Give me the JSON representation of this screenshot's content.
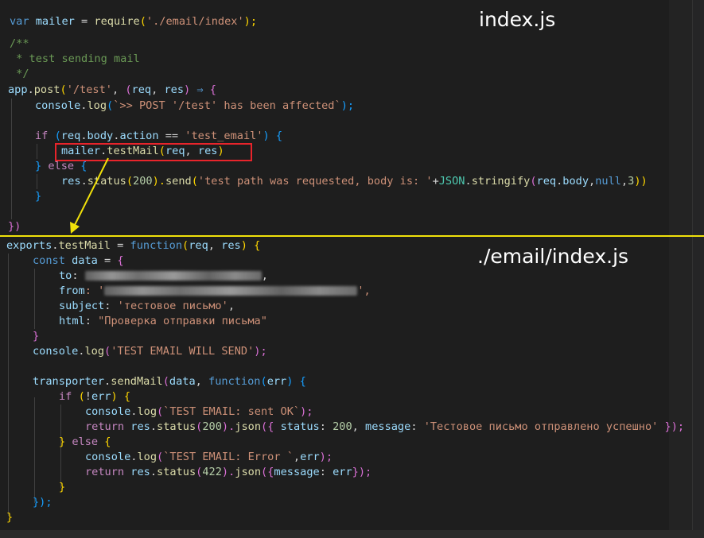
{
  "labels": {
    "top_file": "index.js",
    "bottom_file": "./email/index.js"
  },
  "colors": {
    "divider": "#f1e10a",
    "highlight_box": "#e8242b",
    "arrow": "#f1e10a",
    "background": "#1e1e1e"
  },
  "top": {
    "l1": {
      "a": "var",
      "b": "mailer",
      "c": " = ",
      "d": "require",
      "e": "(",
      "f": "'./email/index'",
      "g": ");"
    },
    "l2": {
      "a": "/**"
    },
    "l3": {
      "a": " * test sending mail"
    },
    "l4": {
      "a": " */"
    },
    "l5": {
      "a": "app",
      "b": ".",
      "c": "post",
      "d": "(",
      "e": "'/test'",
      "f": ", ",
      "g": "(",
      "h": "req",
      "i": ", ",
      "j": "res",
      "k": ")",
      "l": " ⇒ ",
      "m": "{"
    },
    "l6": {
      "a": "console",
      "b": ".",
      "c": "log",
      "d": "(",
      "e": "`>> POST '/test' has been affected`",
      "f": ");"
    },
    "l7": {
      "a": "if",
      "b": " ",
      "c": "(",
      "d": "req",
      "e": ".",
      "f": "body",
      "g": ".",
      "h": "action",
      "i": " == ",
      "j": "'test_email'",
      "k": ")",
      "l": " {"
    },
    "l8": {
      "a": "mailer",
      "b": ".",
      "c": "testMail",
      "d": "(",
      "e": "req",
      "f": ", ",
      "g": "res",
      "h": ")"
    },
    "l9": {
      "a": "}",
      "b": " else ",
      "c": "{"
    },
    "l10": {
      "a": "res",
      "b": ".",
      "c": "status",
      "d": "(",
      "e": "200",
      "f": ").",
      "g": "send",
      "h": "(",
      "i": "'test path was requested, body is: '",
      "j": "+",
      "k": "JSON",
      "l": ".",
      "m": "stringify",
      "n": "(",
      "o": "req",
      "p": ".",
      "q": "body",
      "r": ",",
      "s": "null",
      "t": ",",
      "u": "3",
      "v": "))"
    },
    "l11": {
      "a": "}"
    },
    "l12": {
      "a": "})"
    }
  },
  "bottom": {
    "l1": {
      "a": "exports",
      "b": ".",
      "c": "testMail",
      "d": " = ",
      "e": "function",
      "f": "(",
      "g": "req",
      "h": ", ",
      "i": "res",
      "j": ")",
      "k": " {"
    },
    "l2": {
      "a": "const",
      "b": " ",
      "c": "data",
      "d": " = ",
      "e": "{"
    },
    "l3": {
      "a": "to",
      "b": ": ",
      "c": ","
    },
    "l4": {
      "a": "from",
      "b": ": '",
      "c": "',"
    },
    "l5": {
      "a": "subject",
      "b": ": ",
      "c": "'тестовое письмо'",
      "d": ","
    },
    "l6": {
      "a": "html",
      "b": ": ",
      "c": "\"Проверка отправки письма\""
    },
    "l7": {
      "a": "}"
    },
    "l8": {
      "a": "console",
      "b": ".",
      "c": "log",
      "d": "(",
      "e": "'TEST EMAIL WILL SEND'",
      "f": ");"
    },
    "l9": {
      "a": "transporter",
      "b": ".",
      "c": "sendMail",
      "d": "(",
      "e": "data",
      "f": ", ",
      "g": "function",
      "h": "(",
      "i": "err",
      "j": ")",
      "k": " {"
    },
    "l10": {
      "a": "if",
      "b": " ",
      "c": "(",
      "d": "!",
      "e": "err",
      "f": ")",
      "g": " {"
    },
    "l11": {
      "a": "console",
      "b": ".",
      "c": "log",
      "d": "(",
      "e": "`TEST EMAIL: sent OK`",
      "f": ");"
    },
    "l12": {
      "a": "return",
      "b": " ",
      "c": "res",
      "d": ".",
      "e": "status",
      "f": "(",
      "g": "200",
      "h": ").",
      "i": "json",
      "j": "({ ",
      "k": "status",
      "l": ": ",
      "m": "200",
      "n": ", ",
      "o": "message",
      "p": ": ",
      "q": "'Тестовое письмо отправлено успешно'",
      "r": " });"
    },
    "l13": {
      "a": "}",
      "b": " else ",
      "c": "{"
    },
    "l14": {
      "a": "console",
      "b": ".",
      "c": "log",
      "d": "(",
      "e": "`TEST EMAIL: Error `",
      "f": ",",
      "g": "err",
      "h": ");"
    },
    "l15": {
      "a": "return",
      "b": " ",
      "c": "res",
      "d": ".",
      "e": "status",
      "f": "(",
      "g": "422",
      "h": ").",
      "i": "json",
      "j": "({",
      "k": "message",
      "l": ": ",
      "m": "err",
      "n": "});"
    },
    "l16": {
      "a": "}"
    },
    "l17": {
      "a": "});"
    },
    "l18": {
      "a": "}"
    }
  }
}
